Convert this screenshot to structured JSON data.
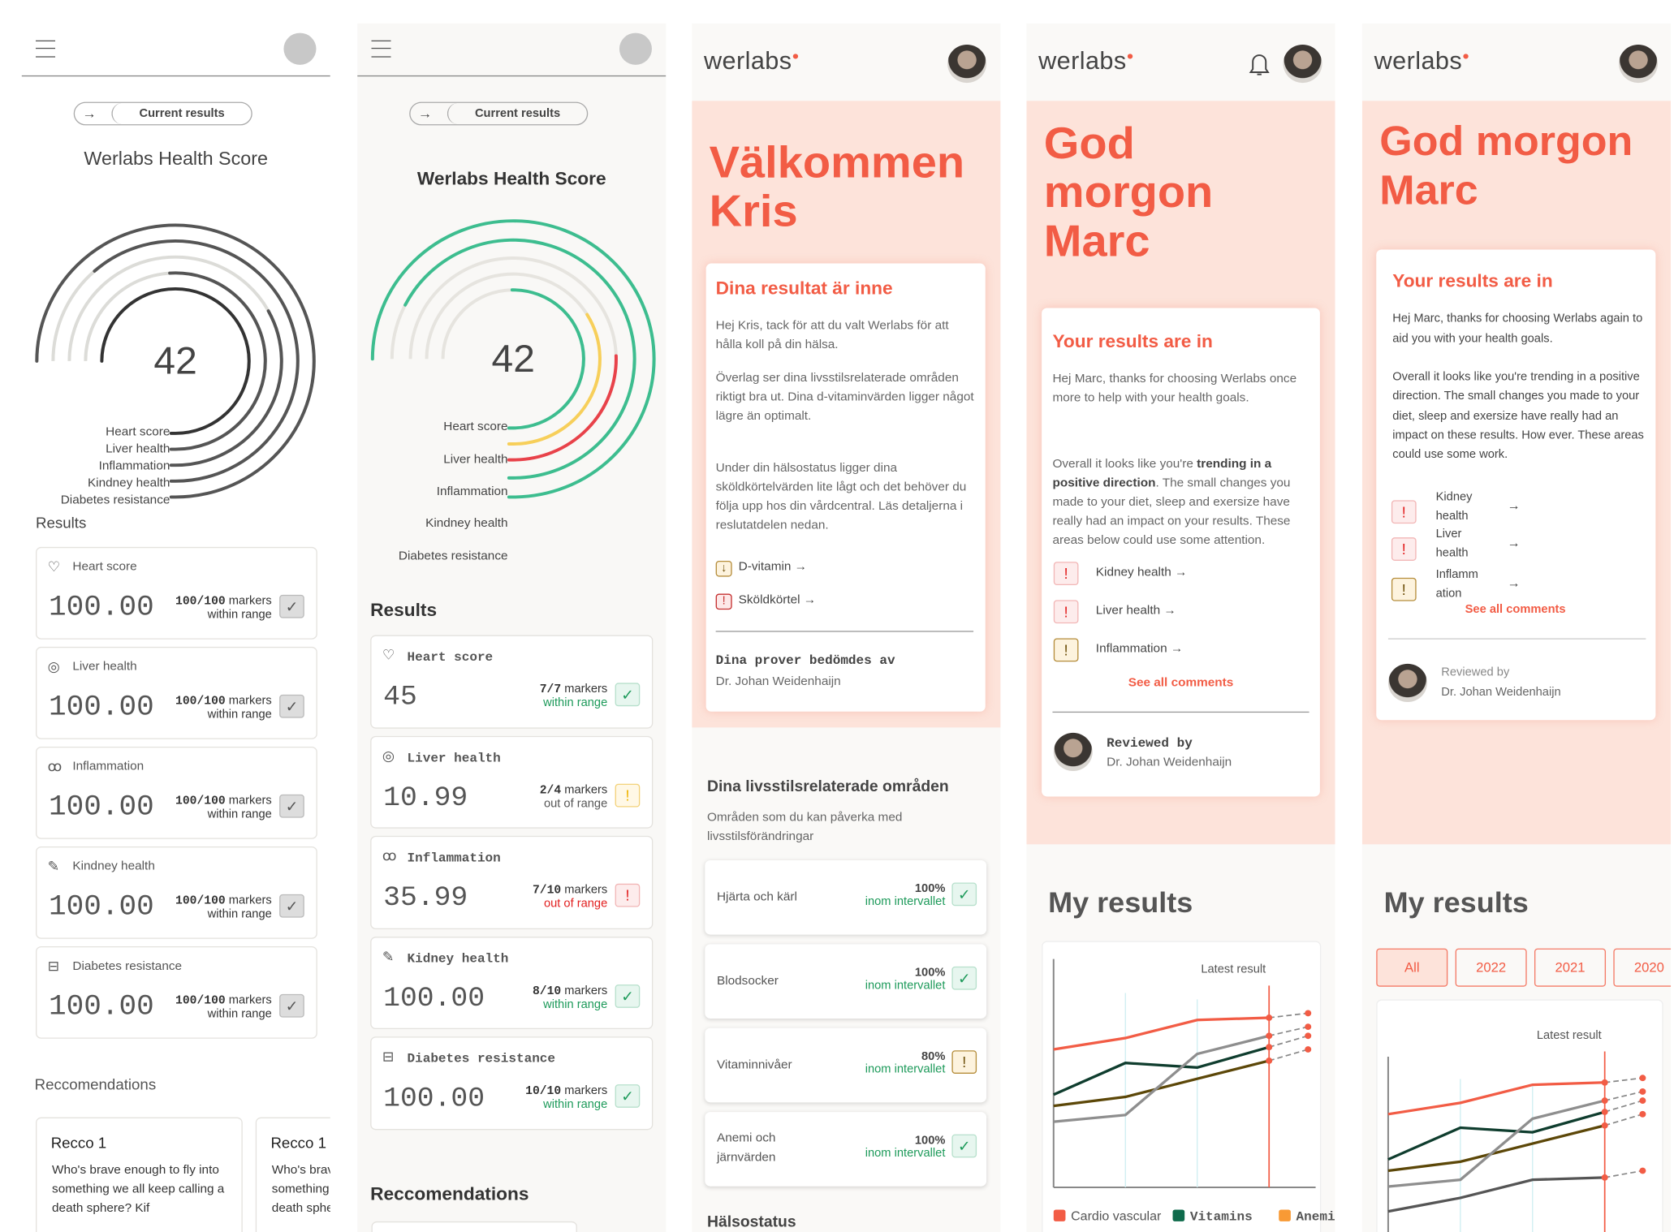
{
  "colors": {
    "accent": "#f25c45",
    "salmon": "#fde3da",
    "green": "#1d9a5a",
    "yellow": "#f0b400",
    "red": "#e21e1e"
  },
  "screens": [
    {
      "header": {
        "menu_icon": "hamburger-icon",
        "avatar": "avatar-placeholder"
      },
      "pill": {
        "icon": "arrow-right-icon",
        "label": "Current results"
      },
      "title": "Werlabs Health Score",
      "score": "42",
      "gauge": [
        {
          "label": "Heart score",
          "level": 1.0
        },
        {
          "label": "Liver health",
          "level": 0.68
        },
        {
          "label": "Inflammation",
          "level": 0.44
        },
        {
          "label": "Kindney health",
          "level": 0.82
        },
        {
          "label": "Diabetes resistance",
          "level": 1.0
        }
      ],
      "results_heading": "Results",
      "results": [
        {
          "icon": "heart-check-icon",
          "title": "Heart score",
          "value": "100.00",
          "count": "100/100",
          "markers": "markers",
          "range": "within range",
          "status": "ok"
        },
        {
          "icon": "target-icon",
          "title": "Liver health",
          "value": "100.00",
          "count": "100/100",
          "markers": "markers",
          "range": "within range",
          "status": "ok"
        },
        {
          "icon": "kidney-icon",
          "title": "Inflammation",
          "value": "100.00",
          "count": "100/100",
          "markers": "markers",
          "range": "within range",
          "status": "ok"
        },
        {
          "icon": "syringe-icon",
          "title": "Kindney health",
          "value": "100.00",
          "count": "100/100",
          "markers": "markers",
          "range": "within range",
          "status": "ok"
        },
        {
          "icon": "layout-icon",
          "title": "Diabetes resistance",
          "value": "100.00",
          "count": "100/100",
          "markers": "markers",
          "range": "within range",
          "status": "ok"
        }
      ],
      "recommendations_heading": "Reccomendations",
      "recommendations": [
        {
          "title": "Recco 1",
          "text": "Who's brave enough to fly into something we all keep calling a death sphere? Kif"
        },
        {
          "title": "Recco 1",
          "text": "Who's brave enough to fly into something we all keep calling a death sphere? Kif"
        }
      ]
    },
    {
      "pill": {
        "icon": "arrow-right-icon",
        "label": "Current results"
      },
      "title": "Werlabs Health Score",
      "score": "42",
      "gauge": [
        {
          "label": "Heart score",
          "level": 0.67,
          "color": "#3dbd8f"
        },
        {
          "label": "Liver health",
          "level": 0.45,
          "color": "#f7cf5a"
        },
        {
          "label": "Inflammation",
          "level": 0.34,
          "color": "#e8424a"
        },
        {
          "label": "Kindney health",
          "level": 0.9,
          "color": "#3dbd8f"
        },
        {
          "label": "Diabetes resistance",
          "level": 1.0,
          "color": "#3dbd8f"
        }
      ],
      "results_heading": "Results",
      "results": [
        {
          "icon": "heart-check-icon",
          "title": "Heart score",
          "value": "45",
          "count": "7/7",
          "markers": "markers",
          "range": "within range",
          "status": "ok"
        },
        {
          "icon": "liver-icon",
          "title": "Liver health",
          "value": "10.99",
          "count": "2/4",
          "markers": "markers",
          "range": "out of range",
          "status": "warn"
        },
        {
          "icon": "target-icon",
          "title": "Inflammation",
          "value": "35.99",
          "count": "7/10",
          "markers": "markers",
          "range": "out of range",
          "status": "alert"
        },
        {
          "icon": "kidney-icon",
          "title": "Kidney health",
          "value": "100.00",
          "count": "8/10",
          "markers": "markers",
          "range": "within range",
          "status": "ok"
        },
        {
          "icon": "bandage-icon",
          "title": "Diabetes resistance",
          "value": "100.00",
          "count": "10/10",
          "markers": "markers",
          "range": "within range",
          "status": "ok"
        }
      ],
      "recommendations_heading": "Reccomendations"
    },
    {
      "logo": "werlabs",
      "greeting": [
        "Välkommen",
        "Kris"
      ],
      "card": {
        "title": "Dina resultat är inne",
        "paragraphs": [
          "Hej Kris, tack för att du valt Werlabs för att hålla koll på din hälsa.",
          "Överlag ser dina livsstilsrelaterade områden riktigt bra ut. Dina d-vitaminvärden ligger något lägre än optimalt.",
          "Under din hälsostatus ligger dina sköldkörtelvärden lite lågt och det behöver du följa upp hos din vårdcentral. Läs detaljerna i reslutatdelen nedan."
        ],
        "links": [
          {
            "icon": "arrow-down-icon",
            "label": "D-vitamin →",
            "status": "low"
          },
          {
            "icon": "exclamation-icon",
            "label": "Sköldkörtel →",
            "status": "alert"
          }
        ],
        "reviewed_label": "Dina prover bedömdes av",
        "doctor": "Dr. Johan Weidenhaijn"
      },
      "lifestyle": {
        "title": "Dina livsstilsrelaterade områden",
        "subtitle": "Områden som du kan påverka med livsstilsförändringar",
        "items": [
          {
            "label": "Hjärta och kärl",
            "percent": "100%",
            "range": "inom intervallet",
            "status": "ok"
          },
          {
            "label": "Blodsocker",
            "percent": "100%",
            "range": "inom intervallet",
            "status": "ok"
          },
          {
            "label": "Vitaminnivåer",
            "percent": "80%",
            "range": "inom intervallet",
            "status": "warn"
          },
          {
            "label": "Anemi och järnvärden",
            "percent": "100%",
            "range": "inom intervallet",
            "status": "ok"
          }
        ]
      },
      "next_heading": "Hälsostatus"
    },
    {
      "logo": "werlabs",
      "bell_icon": "bell-icon",
      "greeting": [
        "God",
        "morgon",
        "Marc"
      ],
      "card": {
        "title": "Your results are in",
        "p1": "Hej Marc, thanks for choosing Werlabs once more to help with your health goals.",
        "p2_pre": "Overall it looks like you're ",
        "p2_bold": "trending in a positive direction",
        "p2_post": ". The small changes you made to your diet, sleep and exersize have really had an impact on your results. These areas below could use some attention.",
        "links": [
          {
            "label": "Kidney health →",
            "status": "alert"
          },
          {
            "label": "Liver health →",
            "status": "alert"
          },
          {
            "label": "Inflammation →",
            "status": "warn"
          }
        ],
        "see_all": "See all comments",
        "reviewed_label": "Reviewed by",
        "doctor": "Dr. Johan Weidenhaijn"
      },
      "my_results": "My results",
      "latest": "Latest result",
      "legend": [
        {
          "label": "Cardio vascular",
          "color": "#f25c45"
        },
        {
          "label": "Vitamins",
          "color": "#0f6b4c"
        },
        {
          "label": "Anemi",
          "color": "#f89a35"
        }
      ]
    },
    {
      "logo": "werlabs",
      "greeting": [
        "God morgon",
        "Marc"
      ],
      "card": {
        "title": "Your results are in",
        "p1": "Hej Marc, thanks for choosing Werlabs again to aid you with your health goals.",
        "p2": "Overall it looks like you're trending in a positive direction. The small changes you made to your diet, sleep and exersize have really had an impact on these results. How ever. These areas could use some work.",
        "links": [
          {
            "label": [
              "Kidney",
              "health"
            ],
            "status": "alert"
          },
          {
            "label": [
              "Liver",
              "health"
            ],
            "status": "alert"
          },
          {
            "label": [
              "Inflamm",
              "ation"
            ],
            "status": "warn"
          }
        ],
        "see_all": "See all comments",
        "reviewed_label": "Reviewed by",
        "doctor": "Dr. Johan Weidenhaijn"
      },
      "my_results": "My results",
      "tabs": [
        {
          "label": "All",
          "active": true
        },
        {
          "label": "2022"
        },
        {
          "label": "2021"
        },
        {
          "label": "2020"
        }
      ],
      "latest": "Latest result"
    }
  ],
  "chart_data": [
    {
      "type": "line",
      "title": "",
      "latest_marker": "Latest result",
      "x": [
        1,
        2,
        3,
        4
      ],
      "projected_x": 5,
      "legend": [
        "Cardio vascular",
        "Vitamins",
        "Anemi"
      ],
      "series": [
        {
          "color": "#f25c45",
          "values": [
            61,
            66,
            74,
            75
          ],
          "projected": 77
        },
        {
          "color": "#0f3d2e",
          "values": [
            41,
            55,
            53,
            62
          ],
          "projected": 67
        },
        {
          "color": "#5c4708",
          "values": [
            36,
            40,
            48,
            56
          ],
          "projected": 61
        },
        {
          "color": "#8e8e8e",
          "values": [
            29,
            32,
            59,
            67
          ],
          "projected": 71
        }
      ],
      "ylim": [
        0,
        100
      ],
      "grid": "vertical"
    },
    {
      "type": "line",
      "title": "",
      "latest_marker": "Latest result",
      "x": [
        1,
        2,
        3,
        4
      ],
      "projected_x": 5,
      "series": [
        {
          "color": "#f25c45",
          "values": [
            61,
            66,
            74,
            75
          ],
          "projected": 77
        },
        {
          "color": "#0f3d2e",
          "values": [
            41,
            55,
            53,
            62
          ],
          "projected": 67
        },
        {
          "color": "#5c4708",
          "values": [
            36,
            40,
            48,
            56
          ],
          "projected": 61
        },
        {
          "color": "#8e8e8e",
          "values": [
            29,
            32,
            59,
            67
          ],
          "projected": 71
        },
        {
          "color": "#555555",
          "values": [
            18,
            24,
            32,
            33
          ],
          "projected": 36
        }
      ],
      "ylim": [
        0,
        100
      ],
      "grid": "vertical"
    }
  ]
}
